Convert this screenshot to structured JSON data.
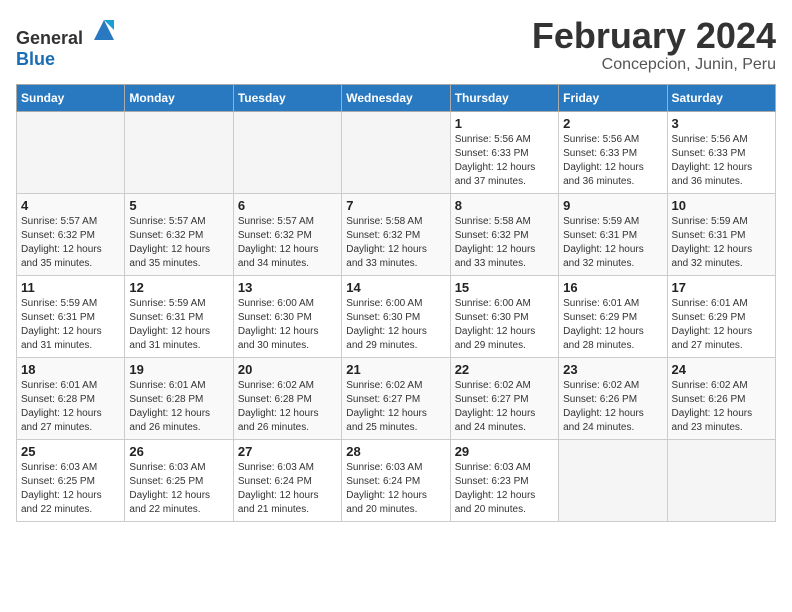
{
  "header": {
    "logo_general": "General",
    "logo_blue": "Blue",
    "main_title": "February 2024",
    "subtitle": "Concepcion, Junin, Peru"
  },
  "calendar": {
    "weekdays": [
      "Sunday",
      "Monday",
      "Tuesday",
      "Wednesday",
      "Thursday",
      "Friday",
      "Saturday"
    ],
    "weeks": [
      [
        {
          "day": "",
          "detail": ""
        },
        {
          "day": "",
          "detail": ""
        },
        {
          "day": "",
          "detail": ""
        },
        {
          "day": "",
          "detail": ""
        },
        {
          "day": "1",
          "detail": "Sunrise: 5:56 AM\nSunset: 6:33 PM\nDaylight: 12 hours\nand 37 minutes."
        },
        {
          "day": "2",
          "detail": "Sunrise: 5:56 AM\nSunset: 6:33 PM\nDaylight: 12 hours\nand 36 minutes."
        },
        {
          "day": "3",
          "detail": "Sunrise: 5:56 AM\nSunset: 6:33 PM\nDaylight: 12 hours\nand 36 minutes."
        }
      ],
      [
        {
          "day": "4",
          "detail": "Sunrise: 5:57 AM\nSunset: 6:32 PM\nDaylight: 12 hours\nand 35 minutes."
        },
        {
          "day": "5",
          "detail": "Sunrise: 5:57 AM\nSunset: 6:32 PM\nDaylight: 12 hours\nand 35 minutes."
        },
        {
          "day": "6",
          "detail": "Sunrise: 5:57 AM\nSunset: 6:32 PM\nDaylight: 12 hours\nand 34 minutes."
        },
        {
          "day": "7",
          "detail": "Sunrise: 5:58 AM\nSunset: 6:32 PM\nDaylight: 12 hours\nand 33 minutes."
        },
        {
          "day": "8",
          "detail": "Sunrise: 5:58 AM\nSunset: 6:32 PM\nDaylight: 12 hours\nand 33 minutes."
        },
        {
          "day": "9",
          "detail": "Sunrise: 5:59 AM\nSunset: 6:31 PM\nDaylight: 12 hours\nand 32 minutes."
        },
        {
          "day": "10",
          "detail": "Sunrise: 5:59 AM\nSunset: 6:31 PM\nDaylight: 12 hours\nand 32 minutes."
        }
      ],
      [
        {
          "day": "11",
          "detail": "Sunrise: 5:59 AM\nSunset: 6:31 PM\nDaylight: 12 hours\nand 31 minutes."
        },
        {
          "day": "12",
          "detail": "Sunrise: 5:59 AM\nSunset: 6:31 PM\nDaylight: 12 hours\nand 31 minutes."
        },
        {
          "day": "13",
          "detail": "Sunrise: 6:00 AM\nSunset: 6:30 PM\nDaylight: 12 hours\nand 30 minutes."
        },
        {
          "day": "14",
          "detail": "Sunrise: 6:00 AM\nSunset: 6:30 PM\nDaylight: 12 hours\nand 29 minutes."
        },
        {
          "day": "15",
          "detail": "Sunrise: 6:00 AM\nSunset: 6:30 PM\nDaylight: 12 hours\nand 29 minutes."
        },
        {
          "day": "16",
          "detail": "Sunrise: 6:01 AM\nSunset: 6:29 PM\nDaylight: 12 hours\nand 28 minutes."
        },
        {
          "day": "17",
          "detail": "Sunrise: 6:01 AM\nSunset: 6:29 PM\nDaylight: 12 hours\nand 27 minutes."
        }
      ],
      [
        {
          "day": "18",
          "detail": "Sunrise: 6:01 AM\nSunset: 6:28 PM\nDaylight: 12 hours\nand 27 minutes."
        },
        {
          "day": "19",
          "detail": "Sunrise: 6:01 AM\nSunset: 6:28 PM\nDaylight: 12 hours\nand 26 minutes."
        },
        {
          "day": "20",
          "detail": "Sunrise: 6:02 AM\nSunset: 6:28 PM\nDaylight: 12 hours\nand 26 minutes."
        },
        {
          "day": "21",
          "detail": "Sunrise: 6:02 AM\nSunset: 6:27 PM\nDaylight: 12 hours\nand 25 minutes."
        },
        {
          "day": "22",
          "detail": "Sunrise: 6:02 AM\nSunset: 6:27 PM\nDaylight: 12 hours\nand 24 minutes."
        },
        {
          "day": "23",
          "detail": "Sunrise: 6:02 AM\nSunset: 6:26 PM\nDaylight: 12 hours\nand 24 minutes."
        },
        {
          "day": "24",
          "detail": "Sunrise: 6:02 AM\nSunset: 6:26 PM\nDaylight: 12 hours\nand 23 minutes."
        }
      ],
      [
        {
          "day": "25",
          "detail": "Sunrise: 6:03 AM\nSunset: 6:25 PM\nDaylight: 12 hours\nand 22 minutes."
        },
        {
          "day": "26",
          "detail": "Sunrise: 6:03 AM\nSunset: 6:25 PM\nDaylight: 12 hours\nand 22 minutes."
        },
        {
          "day": "27",
          "detail": "Sunrise: 6:03 AM\nSunset: 6:24 PM\nDaylight: 12 hours\nand 21 minutes."
        },
        {
          "day": "28",
          "detail": "Sunrise: 6:03 AM\nSunset: 6:24 PM\nDaylight: 12 hours\nand 20 minutes."
        },
        {
          "day": "29",
          "detail": "Sunrise: 6:03 AM\nSunset: 6:23 PM\nDaylight: 12 hours\nand 20 minutes."
        },
        {
          "day": "",
          "detail": ""
        },
        {
          "day": "",
          "detail": ""
        }
      ]
    ]
  }
}
